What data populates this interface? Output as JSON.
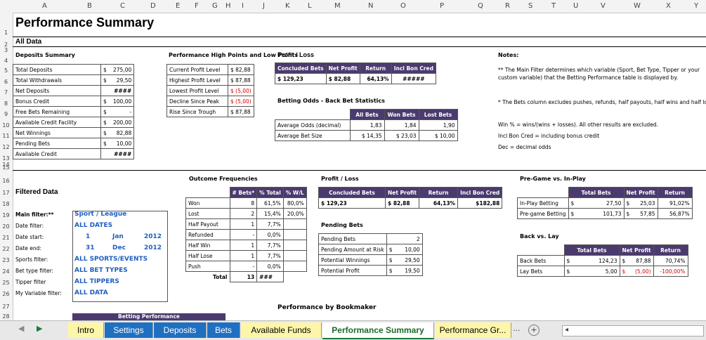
{
  "columns": [
    "A",
    "B",
    "C",
    "D",
    "E",
    "F",
    "G",
    "H",
    "I",
    "J",
    "K",
    "L",
    "M",
    "N",
    "O",
    "P",
    "Q",
    "R",
    "S",
    "T",
    "U",
    "V",
    "W",
    "X",
    "Y"
  ],
  "rows": [
    "1",
    "2",
    "3",
    "4",
    "5",
    "6",
    "7",
    "8",
    "9",
    "10",
    "11",
    "12",
    "13",
    "14",
    "15",
    "16",
    "17",
    "18",
    "19",
    "20",
    "21",
    "22",
    "23",
    "24",
    "25",
    "26",
    "27",
    "28"
  ],
  "title": "Performance Summary",
  "all_data": "All Data",
  "deposits_summary": {
    "heading": "Deposits Summary",
    "rows": [
      {
        "label": "Total Deposits",
        "cur": "$",
        "val": "275,00"
      },
      {
        "label": "Total Withdrawals",
        "cur": "$",
        "val": "29,50"
      },
      {
        "label": "Net Deposits",
        "cur": "",
        "val": "####"
      },
      {
        "label": "Bonus Credit",
        "cur": "$",
        "val": "100,00"
      },
      {
        "label": "Free Bets Remaining",
        "cur": "$",
        "val": "-"
      },
      {
        "label": "Available Credit Facility",
        "cur": "$",
        "val": "200,00"
      },
      {
        "label": "Net Winnings",
        "cur": "$",
        "val": "82,88"
      },
      {
        "label": "Pending Bets",
        "cur": "$",
        "val": "10,00"
      },
      {
        "label": "Available Credit",
        "cur": "",
        "val": "####"
      }
    ]
  },
  "high_points": {
    "heading": "Performance High Points and Low Points",
    "rows": [
      {
        "label": "Current Profit Level",
        "val": "$ 82,88",
        "red": false
      },
      {
        "label": "Highest Profit Level",
        "val": "$ 87,88",
        "red": false
      },
      {
        "label": "Lowest Profit Level",
        "val": "$  (5,00)",
        "red": true
      },
      {
        "label": "Decline Since Peak",
        "val": "$  (5,00)",
        "red": true
      },
      {
        "label": "Rise Since Trough",
        "val": "$ 87,88",
        "red": false
      }
    ]
  },
  "profit_loss_top": {
    "heading": "Profit / Loss",
    "headers": [
      "Concluded Bets",
      "Net Profit",
      "Return",
      "Incl Bon Cred"
    ],
    "values": [
      "$      129,23",
      "$  82,88",
      "64,13%",
      "#####"
    ]
  },
  "betting_odds": {
    "heading": "Betting Odds - Back Bet Statistics",
    "headers": [
      "All Bets",
      "Won Bets",
      "Lost Bets"
    ],
    "rows": [
      {
        "label": "Average Odds (decimal)",
        "vals": [
          "1,83",
          "1,84",
          "1,90"
        ]
      },
      {
        "label": "Average Bet Size",
        "vals": [
          "$      14,35",
          "$      23,03",
          "$      10,00"
        ]
      }
    ]
  },
  "notes": {
    "heading": "Notes:",
    "lines": [
      "** The Main Filter determines which variable (Sport, Bet Type, Tipper or your",
      "custom variable) that the Betting Performance table is displayed by.",
      "* The Bets column excludes pushes, refunds, half payouts, half wins and half losses.",
      "Win % = wins/(wins + losses).  All other results are excluded.",
      "Incl Bon Cred = including bonus credit",
      "Dec = decimal odds"
    ]
  },
  "filtered_data": {
    "heading": "Filtered Data",
    "rows": [
      {
        "label": "Main filter:**",
        "val": "Sport / League"
      },
      {
        "label": "Date filter:",
        "val": "ALL DATES"
      },
      {
        "label": "Date start:",
        "vals": [
          "1",
          "Jan",
          "2012"
        ]
      },
      {
        "label": "Date end:",
        "vals": [
          "31",
          "Dec",
          "2012"
        ]
      },
      {
        "label": "Sports filter:",
        "val": "ALL SPORTS/EVENTS"
      },
      {
        "label": "Bet type filter:",
        "val": "ALL BET TYPES"
      },
      {
        "label": "Tipper filter",
        "val": "ALL TIPPERS"
      },
      {
        "label": "My Variable filter:",
        "val": "ALL DATA"
      }
    ]
  },
  "outcome": {
    "heading": "Outcome Frequencies",
    "headers": [
      "# Bets*",
      "% Total",
      "% W/L"
    ],
    "rows": [
      {
        "label": "Won",
        "vals": [
          "8",
          "61,5%",
          "80,0%"
        ]
      },
      {
        "label": "Lost",
        "vals": [
          "2",
          "15,4%",
          "20,0%"
        ]
      },
      {
        "label": "Half Payout",
        "vals": [
          "1",
          "7,7%",
          ""
        ]
      },
      {
        "label": "Refunded",
        "vals": [
          "-",
          "0,0%",
          ""
        ]
      },
      {
        "label": "Half Win",
        "vals": [
          "1",
          "7,7%",
          ""
        ]
      },
      {
        "label": "Half Lose",
        "vals": [
          "1",
          "7,7%",
          ""
        ]
      },
      {
        "label": "Push",
        "vals": [
          "-",
          "0,0%",
          ""
        ]
      }
    ],
    "total_label": "Total",
    "total_vals": [
      "13",
      "###"
    ]
  },
  "profit_loss_filtered": {
    "heading": "Profit / Loss",
    "headers": [
      "Concluded Bets",
      "Net Profit",
      "Return",
      "Incl Bon Cred"
    ],
    "values": [
      "$           129,23",
      "$  82,88",
      "64,13%",
      "$182,88"
    ]
  },
  "pending": {
    "heading": "Pending Bets",
    "rows": [
      {
        "label": "Pending Bets",
        "cur": "",
        "val": "2"
      },
      {
        "label": "Pending Amount at Risk",
        "cur": "$",
        "val": "10,00"
      },
      {
        "label": "Potential Winnings",
        "cur": "$",
        "val": "29,50"
      },
      {
        "label": "Potential Profit",
        "cur": "$",
        "val": "19,50"
      }
    ]
  },
  "pregame": {
    "heading": "Pre-Game vs. In-Play",
    "headers": [
      "Total Bets",
      "Net Profit",
      "Return"
    ],
    "rows": [
      {
        "label": "In-Play Betting",
        "vals": [
          "$",
          "27,50",
          "$",
          "25,03",
          "91,02%"
        ],
        "red": false
      },
      {
        "label": "Pre-game Betting",
        "vals": [
          "$",
          "101,73",
          "$",
          "57,85",
          "56,87%"
        ],
        "red": false
      }
    ]
  },
  "backlay": {
    "heading": "Back vs. Lay",
    "headers": [
      "Total Bets",
      "Net Profit",
      "Return"
    ],
    "rows": [
      {
        "label": "Back Bets",
        "vals": [
          "$",
          "124,23",
          "$",
          "87,88",
          "70,74%"
        ],
        "red": false
      },
      {
        "label": "Lay Bets",
        "vals": [
          "$",
          "5,00",
          "$",
          "(5,00)",
          "-100,00%"
        ],
        "red": true
      }
    ]
  },
  "bookmaker_heading": "Performance by Bookmaker",
  "betting_performance": "Betting Performance",
  "tabs": [
    "Intro",
    "Settings",
    "Deposits",
    "Bets",
    "Available Funds",
    "Performance Summary",
    "Performance Gr..."
  ],
  "tab_more": "...",
  "add_sheet": "+"
}
